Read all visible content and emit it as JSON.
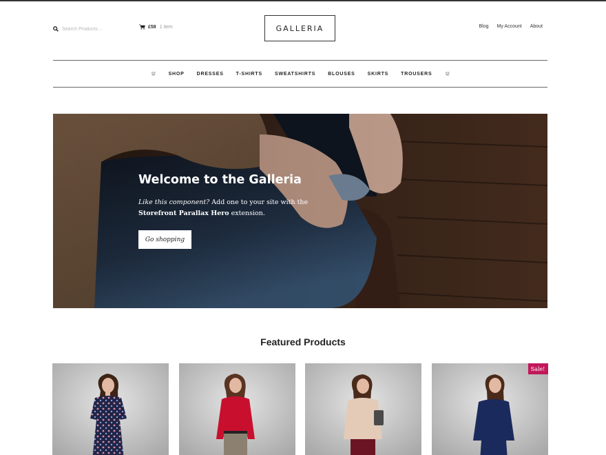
{
  "header": {
    "search_placeholder": "Search Products…",
    "cart_amount": "£58",
    "cart_count": "1 item",
    "logo": "GALLERIA",
    "secondary_nav": [
      "Blog",
      "My Account",
      "About"
    ]
  },
  "main_nav": {
    "items": [
      "SHOP",
      "DRESSES",
      "T-SHIRTS",
      "SWEATSHIRTS",
      "BLOUSES",
      "SKIRTS",
      "TROUSERS"
    ]
  },
  "hero": {
    "title": "Welcome to the Galleria",
    "text_italic": "Like this component?",
    "text_middle": " Add one to your site with the ",
    "text_bold": "Storefront Parallax Hero",
    "text_end": " extension.",
    "button": "Go shopping"
  },
  "featured": {
    "title": "Featured Products",
    "products": [
      {
        "dress_color": "#1f2547",
        "pattern": "floral",
        "badge": ""
      },
      {
        "dress_color": "#c8102e",
        "pattern": "solid",
        "badge": ""
      },
      {
        "dress_color": "#e3cbb8",
        "pattern": "solid",
        "badge": ""
      },
      {
        "dress_color": "#1b2a5c",
        "pattern": "solid",
        "badge": "Sale!"
      }
    ]
  },
  "colors": {
    "accent": "#c2185b",
    "text": "#333333"
  }
}
